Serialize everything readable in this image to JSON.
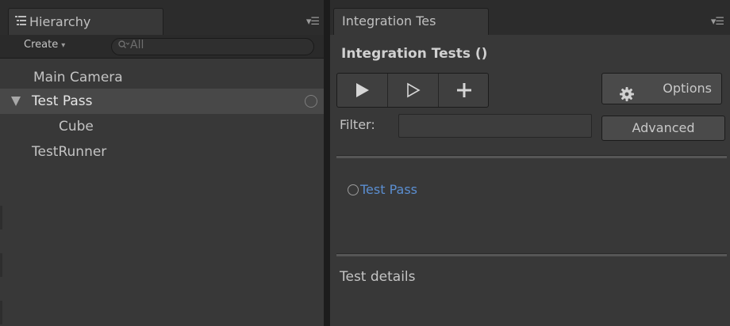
{
  "hierarchy": {
    "tab_label": "Hierarchy",
    "create_label": "Create",
    "search_placeholder": "All",
    "rows": [
      {
        "label": "Main Camera"
      },
      {
        "label": "Test Pass",
        "selected": true,
        "expanded": true
      },
      {
        "label": "Cube"
      },
      {
        "label": "TestRunner"
      }
    ]
  },
  "integration": {
    "tab_label": "Integration Tes",
    "title": "Integration Tests ()",
    "options_label": "Options",
    "filter_label": "Filter:",
    "filter_value": "",
    "advanced_label": "Advanced",
    "tests": [
      {
        "label": "Test Pass"
      }
    ],
    "details_title": "Test details"
  },
  "colors": {
    "panel_bg": "#383838",
    "tab_strip_bg": "#2c2c2c",
    "selected_row": "#484848",
    "test_link": "#5b8ed0",
    "text": "#c4c4c4"
  },
  "icons": {
    "hierarchy_tab": "list-icon",
    "search": "search-icon",
    "run_all": "play-filled-icon",
    "run_selected": "play-outline-icon",
    "add": "plus-icon",
    "options": "gear-icon",
    "test_status": "circle-outline-icon"
  }
}
